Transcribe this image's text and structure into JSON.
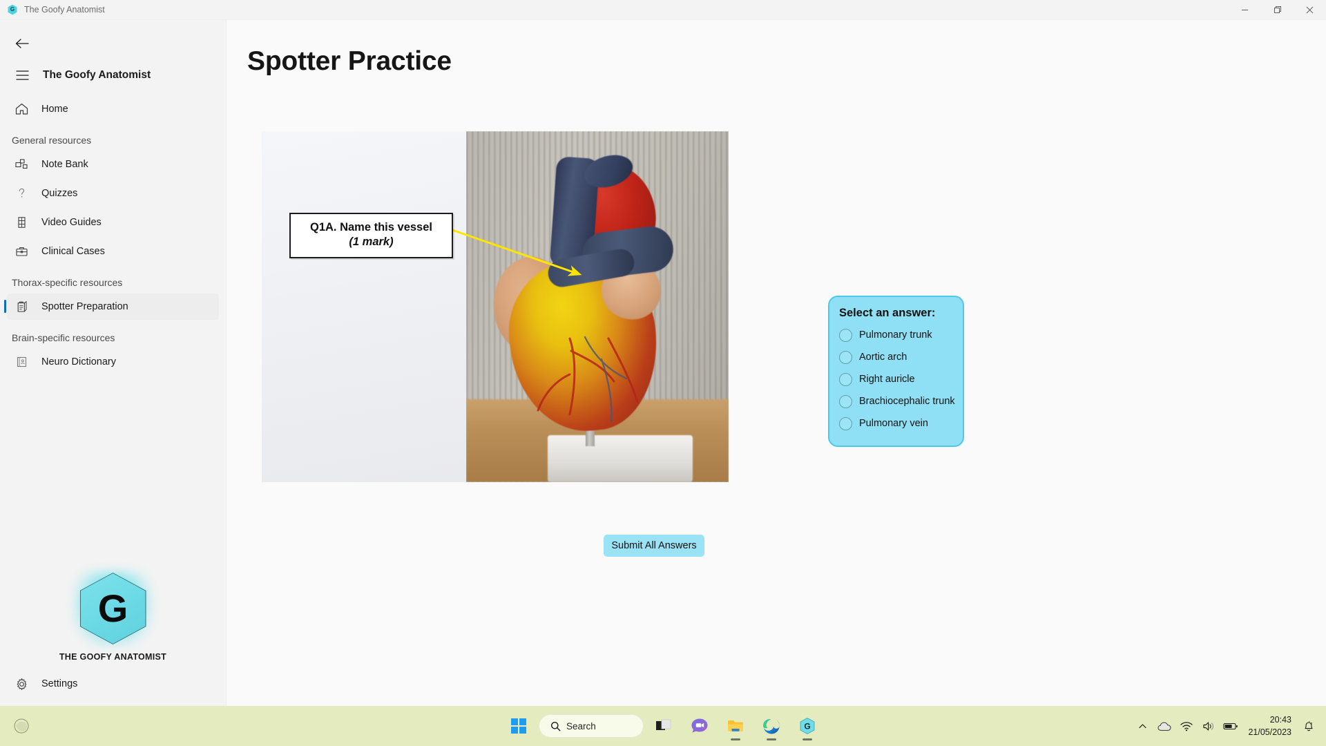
{
  "window": {
    "titlebar": {
      "app_icon": "goofy-anatomist-logo-icon",
      "title": "The Goofy Anatomist",
      "minimize_label": "Minimize",
      "restore_label": "Restore",
      "close_label": "Close"
    }
  },
  "sidebar": {
    "back_label": "Back",
    "menu_label": "Navigation menu",
    "header_title": "The Goofy Anatomist",
    "items": [
      {
        "label": "Home",
        "icon": "home-icon",
        "active": false
      },
      {
        "label": "Note Bank",
        "icon": "note-bank-icon",
        "active": false
      },
      {
        "label": "Quizzes",
        "icon": "question-mark-icon",
        "active": false
      },
      {
        "label": "Video Guides",
        "icon": "film-icon",
        "active": false
      },
      {
        "label": "Clinical Cases",
        "icon": "briefcase-icon",
        "active": false
      },
      {
        "label": "Spotter Preparation",
        "icon": "clipboard-icon",
        "active": true
      },
      {
        "label": "Neuro Dictionary",
        "icon": "book-person-icon",
        "active": false
      }
    ],
    "sections": [
      {
        "label": "General resources"
      },
      {
        "label": "Thorax-specific resources"
      },
      {
        "label": "Brain-specific resources"
      }
    ],
    "logo": {
      "letter": "G",
      "caption": "THE GOOFY ANATOMIST",
      "color": "#6fdce8"
    },
    "settings_label": "Settings"
  },
  "main": {
    "page_title": "Spotter Practice",
    "question": {
      "label_line1": "Q1A. Name this vessel",
      "label_line2": "(1 mark)",
      "image_alt": "Anatomical heart model photograph with yellow pointer arrow",
      "pointer_color": "#ffe500"
    },
    "answers": {
      "title": "Select an answer:",
      "panel_color": "#8fe0f5",
      "options": [
        {
          "label": "Pulmonary trunk",
          "selected": false
        },
        {
          "label": "Aortic arch",
          "selected": false
        },
        {
          "label": "Right auricle",
          "selected": false
        },
        {
          "label": "Brachiocephalic trunk",
          "selected": false
        },
        {
          "label": "Pulmonary vein",
          "selected": false
        }
      ]
    },
    "submit_label": "Submit All Answers"
  },
  "taskbar": {
    "start_label": "Start",
    "search_placeholder": "Search",
    "items": [
      {
        "name": "task-view-icon",
        "label": "Task View"
      },
      {
        "name": "chat-icon",
        "label": "Chat"
      },
      {
        "name": "file-explorer-icon",
        "label": "File Explorer"
      },
      {
        "name": "edge-icon",
        "label": "Microsoft Edge"
      },
      {
        "name": "goofy-anatomist-app-icon",
        "label": "The Goofy Anatomist"
      }
    ],
    "tray": {
      "chevron_label": "Show hidden icons",
      "onedrive_label": "OneDrive",
      "wifi_label": "Network",
      "volume_label": "Volume",
      "battery_label": "Battery",
      "notifications_label": "Notifications"
    },
    "clock": {
      "time": "20:43",
      "date": "21/05/2023"
    }
  }
}
